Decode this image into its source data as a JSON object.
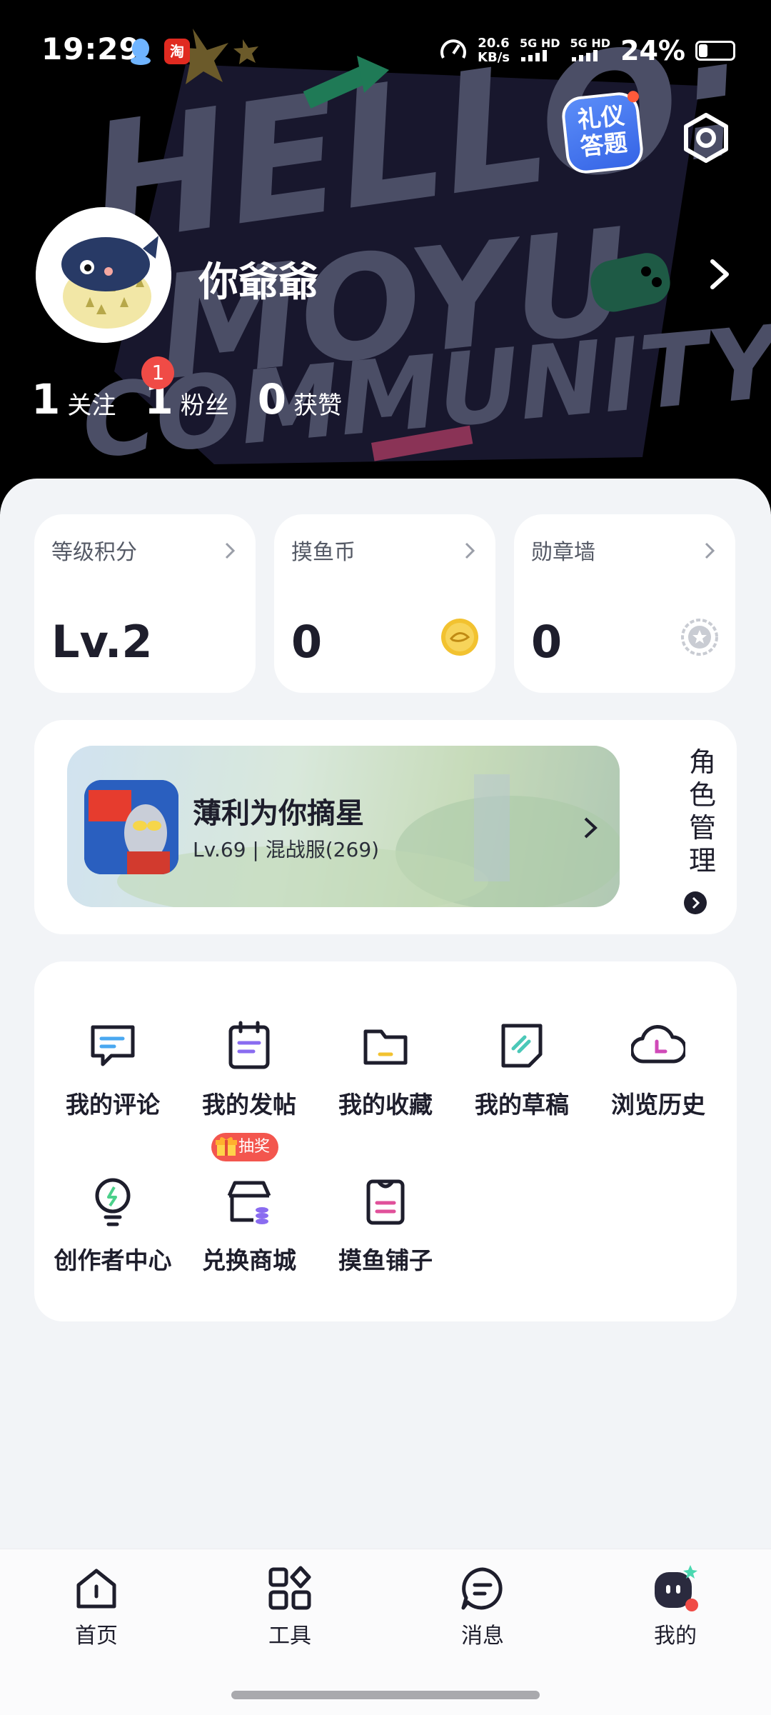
{
  "status_bar": {
    "time": "19:29",
    "speed_value": "20.6",
    "speed_unit": "KB/s",
    "net1": "5G HD",
    "net2": "5G HD",
    "battery": "24%",
    "battery_level": 0.24,
    "taobao": "淘"
  },
  "header": {
    "quiz_badge_line1": "礼仪",
    "quiz_badge_line2": "答题",
    "settings_icon": "settings-hex-icon"
  },
  "profile": {
    "username": "你爺爺",
    "following_count": "1",
    "following_label": "关注",
    "fans_count": "1",
    "fans_label": "粉丝",
    "fans_badge": "1",
    "likes_count": "0",
    "likes_label": "获赞"
  },
  "stat_cards": [
    {
      "title": "等级积分",
      "value": "Lv.2"
    },
    {
      "title": "摸鱼币",
      "value": "0",
      "icon": "coin-icon"
    },
    {
      "title": "勋章墙",
      "value": "0",
      "icon": "medal-icon"
    }
  ],
  "role": {
    "name": "薄利为你摘星",
    "level_info": "Lv.69 | 混战服(269)",
    "manage_label": [
      "角",
      "色",
      "管",
      "理"
    ]
  },
  "menu": {
    "items": [
      {
        "label": "我的评论",
        "icon": "comment-icon"
      },
      {
        "label": "我的发帖",
        "icon": "post-icon"
      },
      {
        "label": "我的收藏",
        "icon": "folder-icon"
      },
      {
        "label": "我的草稿",
        "icon": "draft-icon"
      },
      {
        "label": "浏览历史",
        "icon": "history-icon"
      },
      {
        "label": "创作者中心",
        "icon": "creator-bulb-icon"
      },
      {
        "label": "兑换商城",
        "icon": "shop-icon"
      },
      {
        "label": "摸鱼铺子",
        "icon": "bag-icon"
      }
    ],
    "lottery_tag": "抽奖"
  },
  "bottom_nav": [
    {
      "label": "首页",
      "icon": "home-icon"
    },
    {
      "label": "工具",
      "icon": "tools-icon"
    },
    {
      "label": "消息",
      "icon": "message-icon"
    },
    {
      "label": "我的",
      "icon": "profile-avatar-icon"
    }
  ],
  "colors": {
    "accent_purple": "#8a6cf0",
    "accent_blue": "#4aa8f0",
    "accent_yellow": "#f2c230",
    "badge_red": "#f04b46"
  }
}
